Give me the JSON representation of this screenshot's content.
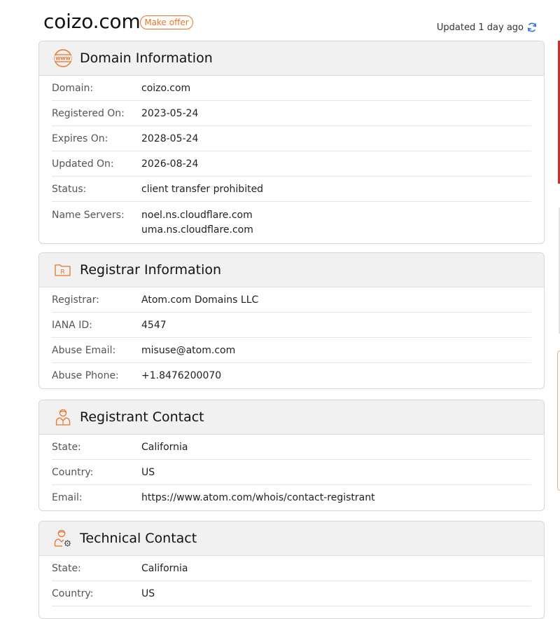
{
  "header": {
    "domain": "coizo.com",
    "offer_label": "Make offer",
    "updated_text": "Updated 1 day ago",
    "refresh_icon": "refresh-icon"
  },
  "colors": {
    "accent": "#e8742a",
    "refresh": "#2f7ad9",
    "card_header_bg": "#f1f1f1"
  },
  "sections": {
    "domain": {
      "title": "Domain Information",
      "icon": "www-icon",
      "rows": [
        {
          "label": "Domain:",
          "value": "coizo.com"
        },
        {
          "label": "Registered On:",
          "value": "2023-05-24"
        },
        {
          "label": "Expires On:",
          "value": "2028-05-24"
        },
        {
          "label": "Updated On:",
          "value": "2026-08-24"
        },
        {
          "label": "Status:",
          "value": "client transfer prohibited"
        },
        {
          "label": "Name Servers:",
          "values": [
            "noel.ns.cloudflare.com",
            "uma.ns.cloudflare.com"
          ]
        }
      ]
    },
    "registrar": {
      "title": "Registrar Information",
      "icon": "registrar-folder-icon",
      "icon_letter": "R",
      "rows": [
        {
          "label": "Registrar:",
          "value": "Atom.com Domains LLC"
        },
        {
          "label": "IANA ID:",
          "value": "4547"
        },
        {
          "label": "Abuse Email:",
          "value": "misuse@atom.com"
        },
        {
          "label": "Abuse Phone:",
          "value": "+1.8476200070"
        }
      ]
    },
    "registrant": {
      "title": "Registrant Contact",
      "icon": "person-icon",
      "rows": [
        {
          "label": "State:",
          "value": "California"
        },
        {
          "label": "Country:",
          "value": "US"
        },
        {
          "label": "Email:",
          "value": "https://www.atom.com/whois/contact-registrant"
        }
      ]
    },
    "technical": {
      "title": "Technical Contact",
      "icon": "person-gear-icon",
      "rows": [
        {
          "label": "State:",
          "value": "California"
        },
        {
          "label": "Country:",
          "value": "US"
        }
      ]
    }
  }
}
